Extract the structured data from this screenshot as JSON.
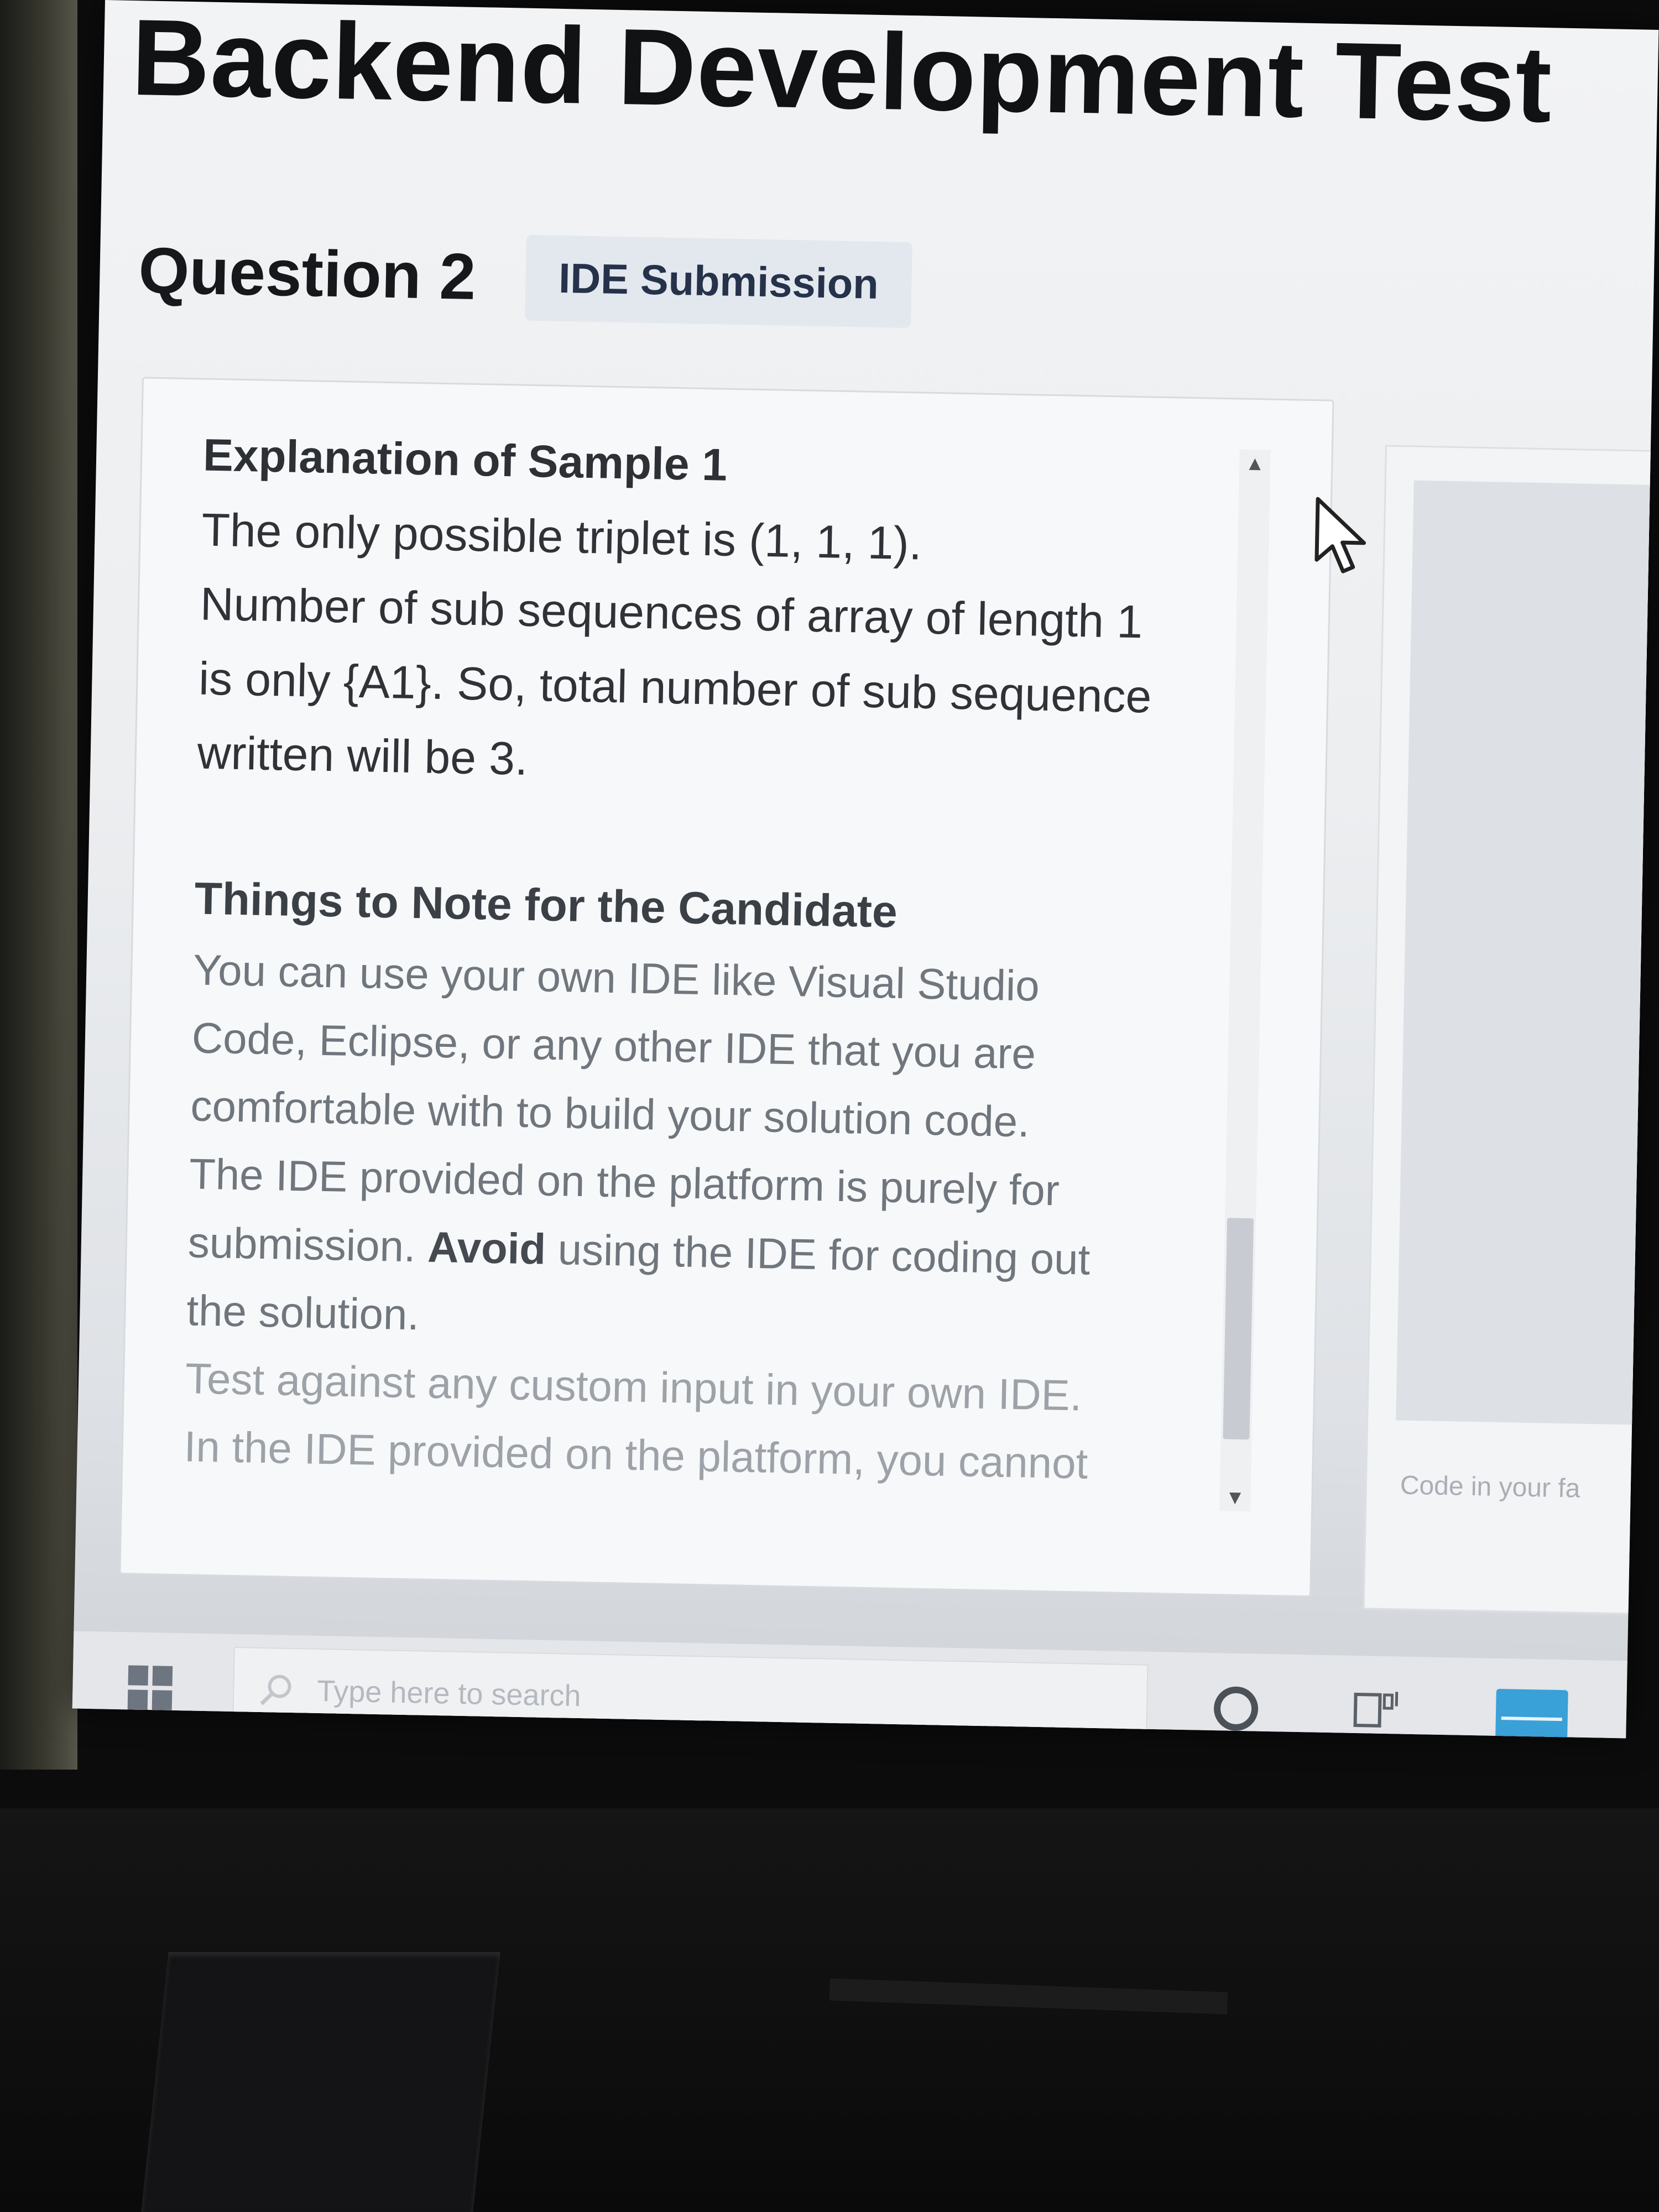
{
  "page": {
    "title": "Backend Development Test"
  },
  "question": {
    "title": "Question 2",
    "badge": "IDE Submission"
  },
  "problem": {
    "sample_heading": "Explanation of Sample 1",
    "sample_lines": [
      "The only possible triplet is (1, 1, 1).",
      "Number of sub sequences of array of length 1",
      "is only {A1}. So, total number of sub sequence",
      "written will be 3."
    ],
    "notes_heading": "Things to Note for the Candidate",
    "notes_lines": [
      "You can use your own IDE like Visual Studio",
      "Code, Eclipse, or any other IDE that you are",
      "comfortable with to build your solution code.",
      "The IDE provided on the platform is purely for",
      "submission.",
      "Avoid",
      "using the IDE for coding out",
      "the solution.",
      "Test against any custom input in your own IDE.",
      "In the IDE provided on the platform, you cannot"
    ]
  },
  "editor": {
    "placeholder": "Code in your fa"
  },
  "taskbar": {
    "search_placeholder": "Type here to search"
  },
  "colors": {
    "badge_bg": "#e3e8ef",
    "mail_icon": "#3aa0d8"
  },
  "icons": {
    "start": "windows-start-icon",
    "search": "search-icon",
    "cortana": "cortana-circle-icon",
    "taskview": "task-view-icon",
    "mail": "mail-icon",
    "pointer": "mouse-pointer-icon"
  }
}
